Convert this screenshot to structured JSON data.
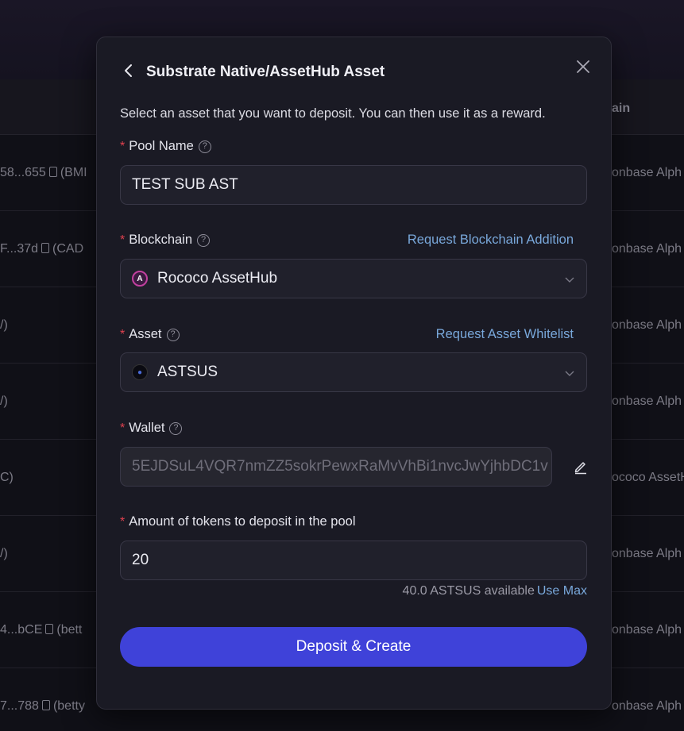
{
  "background": {
    "header_right": "ain",
    "rows": [
      {
        "left": "58...655",
        "left_suffix": "(BMI",
        "right": "onbase Alph",
        "copy": true
      },
      {
        "left": "F...37d",
        "left_suffix": "(CAD",
        "right": "onbase Alph",
        "copy": true
      },
      {
        "left": "/)",
        "left_suffix": "",
        "right": "onbase Alph",
        "copy": false
      },
      {
        "left": "/)",
        "left_suffix": "",
        "right": "onbase Alph",
        "copy": false
      },
      {
        "left": "C)",
        "left_suffix": "",
        "right": "ococo AssetH",
        "copy": false
      },
      {
        "left": "/)",
        "left_suffix": "",
        "right": "onbase Alph",
        "copy": false
      },
      {
        "left": "4...bCE",
        "left_suffix": "(bett",
        "right": "onbase Alph",
        "copy": true
      },
      {
        "left": "7...788",
        "left_suffix": "(betty",
        "right": "onbase Alph",
        "copy": true
      }
    ]
  },
  "modal": {
    "title": "Substrate Native/AssetHub Asset",
    "description": "Select an asset that you want to deposit. You can then use it as a reward.",
    "pool_name": {
      "label": "Pool Name",
      "value": "TEST SUB AST"
    },
    "blockchain": {
      "label": "Blockchain",
      "link": "Request Blockchain Addition",
      "value": "Rococo AssetHub",
      "icon": "rococo-assethub-icon"
    },
    "asset": {
      "label": "Asset",
      "link": "Request Asset Whitelist",
      "value": "ASTSUS",
      "icon": "astsus-token-icon"
    },
    "wallet": {
      "label": "Wallet",
      "value": "5EJDSuL4VQR7nmZZ5sokrPewxRaMvVhBi1nvcJwYjhbDC1v"
    },
    "amount": {
      "label": "Amount of tokens to deposit in the pool",
      "value": "20",
      "available": "40.0 ASTSUS available",
      "use_max": "Use Max"
    },
    "submit_label": "Deposit & Create"
  },
  "colors": {
    "accent": "#3f42d9",
    "link": "#79a8db",
    "required": "#e0414f"
  }
}
